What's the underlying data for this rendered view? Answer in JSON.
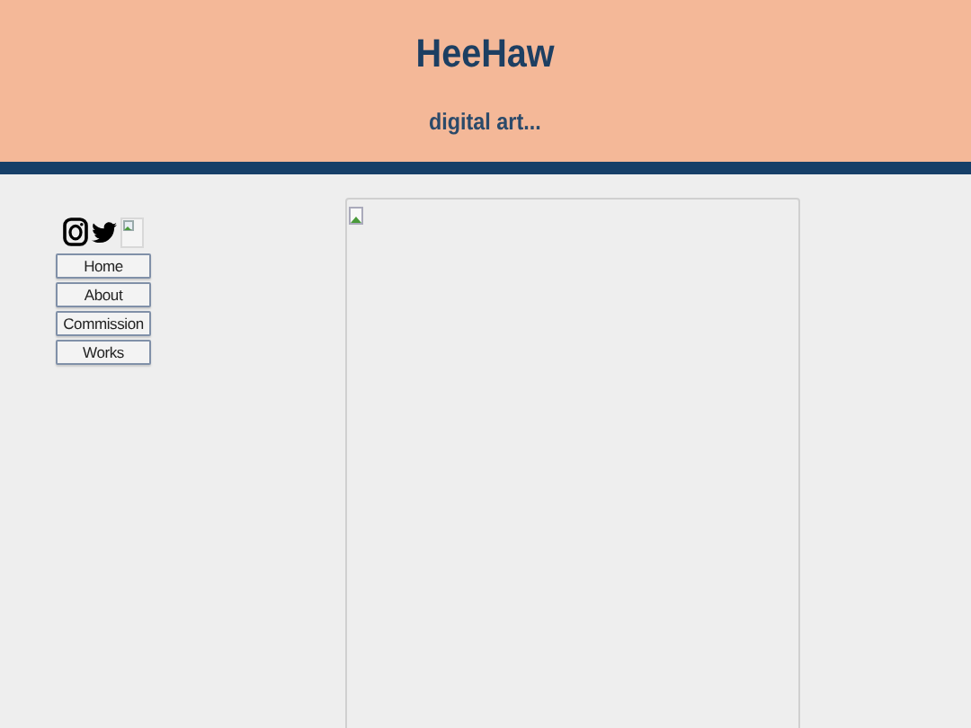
{
  "header": {
    "title": "HeeHaw",
    "subtitle": "digital art..."
  },
  "sidebar": {
    "nav": [
      {
        "label": "Home"
      },
      {
        "label": "About"
      },
      {
        "label": "Commission"
      },
      {
        "label": "Works"
      }
    ]
  }
}
